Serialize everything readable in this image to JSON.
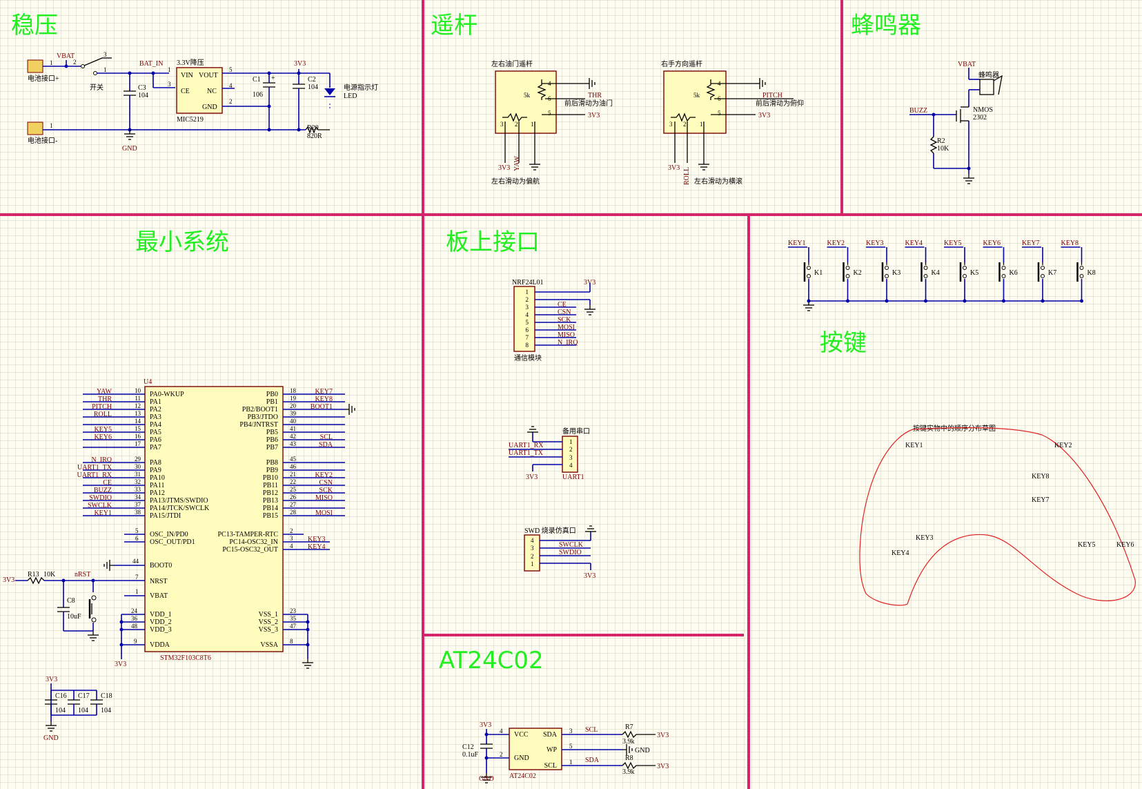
{
  "sections": {
    "regulator": "稳压",
    "joystick": "遥杆",
    "buzzer": "蜂鸣器",
    "min_system": "最小系统",
    "onboard_if": "板上接口",
    "keys": "按键",
    "eeprom": "AT24C02"
  },
  "regulator": {
    "battery_pos": "电池接口+",
    "battery_neg": "电池接口-",
    "vbat": "VBAT",
    "switch": "开关",
    "bat_in": "BAT_IN",
    "reg_title": "3.3V降压",
    "reg_part": "MIC5219",
    "pins": {
      "vin": "VIN",
      "vout": "VOUT",
      "ce": "CE",
      "nc": "NC",
      "gnd": "GND"
    },
    "c3": "C3",
    "c3v": "104",
    "c1": "C1",
    "c1v": "106",
    "c2": "C2",
    "c2v": "104",
    "net3v3": "3V3",
    "led_label": "电源指示灯",
    "led": "LED",
    "r20": "R20",
    "r20v": "820R",
    "gnd": "GND"
  },
  "joystick": {
    "left_title": "左右油门遥杆",
    "left_top_desc": "前后滑动为油门",
    "left_bottom_desc": "左右滑动为偏航",
    "left_net": "THR",
    "left_net2": "YAW",
    "right_title": "右手方向遥杆",
    "right_top_desc": "前后滑动为俯仰",
    "right_bottom_desc": "左右滑动为横滚",
    "right_net": "PITCH",
    "right_net2": "ROLL",
    "pot": "5k",
    "v3": "3V3"
  },
  "buzzer": {
    "vbat": "VBAT",
    "label": "蜂鸣器",
    "buzz": "BUZZ",
    "nmos": "NMOS",
    "part": "2302",
    "r2": "R2",
    "r2v": "10K"
  },
  "mcu": {
    "ref": "U4",
    "part": "STM32F103C8T6",
    "left_pins": [
      {
        "net": "YAW",
        "num": "10",
        "name": "PA0-WKUP"
      },
      {
        "net": "THR",
        "num": "11",
        "name": "PA1"
      },
      {
        "net": "PITCH",
        "num": "12",
        "name": "PA2"
      },
      {
        "net": "ROLL",
        "num": "13",
        "name": "PA3"
      },
      {
        "net": "",
        "num": "14",
        "name": "PA4"
      },
      {
        "net": "KEY5",
        "num": "15",
        "name": "PA5"
      },
      {
        "net": "KEY6",
        "num": "16",
        "name": "PA6"
      },
      {
        "net": "",
        "num": "17",
        "name": "PA7"
      },
      {
        "net": "N_IRQ",
        "num": "29",
        "name": "PA8"
      },
      {
        "net": "UART1_TX",
        "num": "30",
        "name": "PA9"
      },
      {
        "net": "UART1_RX",
        "num": "31",
        "name": "PA10"
      },
      {
        "net": "CE",
        "num": "32",
        "name": "PA11"
      },
      {
        "net": "BUZZ",
        "num": "33",
        "name": "PA12"
      },
      {
        "net": "SWDIO",
        "num": "34",
        "name": "PA13/JTMS/SWDIO"
      },
      {
        "net": "SWCLK",
        "num": "37",
        "name": "PA14/JTCK/SWCLK"
      },
      {
        "net": "KEY1",
        "num": "38",
        "name": "PA15/JTDI"
      }
    ],
    "right_pins": [
      {
        "net": "KEY7",
        "num": "18",
        "name": "PB0"
      },
      {
        "net": "KEY8",
        "num": "19",
        "name": "PB1"
      },
      {
        "net": "BOOT1",
        "num": "20",
        "name": "PB2/BOOT1"
      },
      {
        "net": "",
        "num": "39",
        "name": "PB3/JTDO"
      },
      {
        "net": "",
        "num": "40",
        "name": "PB4/JNTRST"
      },
      {
        "net": "",
        "num": "41",
        "name": "PB5"
      },
      {
        "net": "SCL",
        "num": "42",
        "name": "PB6"
      },
      {
        "net": "SDA",
        "num": "43",
        "name": "PB7"
      },
      {
        "net": "",
        "num": "45",
        "name": "PB8"
      },
      {
        "net": "",
        "num": "46",
        "name": "PB9"
      },
      {
        "net": "KEY2",
        "num": "21",
        "name": "PB10"
      },
      {
        "net": "CSN",
        "num": "22",
        "name": "PB11"
      },
      {
        "net": "SCK",
        "num": "25",
        "name": "PB12"
      },
      {
        "net": "MISO",
        "num": "26",
        "name": "PB13"
      },
      {
        "net": "",
        "num": "27",
        "name": "PB14"
      },
      {
        "net": "MOSI",
        "num": "28",
        "name": "PB15"
      }
    ],
    "osc_in": "OSC_IN/PD0",
    "osc_out": "OSC_OUT/PD1",
    "pc13": "PC13-TAMPER-RTC",
    "pc14": "PC14-OSC32_IN",
    "pc15": "PC15-OSC32_OUT",
    "key3": "KEY3",
    "key4": "KEY4",
    "boot0": "BOOT0",
    "nrst": "NRST",
    "vbat": "VBAT",
    "vdd1": "VDD_1",
    "vdd2": "VDD_2",
    "vdd3": "VDD_3",
    "vdda": "VDDA",
    "vss1": "VSS_1",
    "vss2": "VSS_2",
    "vss3": "VSS_3",
    "vssa": "VSSA",
    "r13": "R13",
    "r13v": "10K",
    "nrst_net": "nRST",
    "c8": "C8",
    "c8v": "10uF",
    "v3": "3V3",
    "c16": "C16",
    "c17": "C17",
    "c18": "C18",
    "cv": "104",
    "gnd": "GND"
  },
  "interfaces": {
    "nrf_title": "NRF24L01",
    "nrf_desc": "通信模块",
    "nrf_nets": [
      "",
      "",
      "CE",
      "CSN",
      "SCK",
      "MOSI",
      "MISO",
      "N_IRQ"
    ],
    "v3": "3V3",
    "uart_title": "备用串口",
    "uart_ref": "UART1",
    "uart_rx": "UART1_RX",
    "uart_tx": "UART1_TX",
    "swd_title": "SWD 烧录仿真口",
    "swclk": "SWCLK",
    "swdio": "SWDIO"
  },
  "keys": {
    "labels": [
      "KEY1",
      "KEY2",
      "KEY3",
      "KEY4",
      "KEY5",
      "KEY6",
      "KEY7",
      "KEY8"
    ],
    "refs": [
      "K1",
      "K2",
      "K3",
      "K4",
      "K5",
      "K6",
      "K7",
      "K8"
    ],
    "layout_title": "按键实物中的顺序分布草图"
  },
  "eeprom": {
    "v3": "3V3",
    "c12": "C12",
    "c12v": "0.1uF",
    "vcc": "VCC",
    "gnd": "GND",
    "sda": "SDA",
    "wp": "WP",
    "scl": "SCL",
    "part": "AT24C02",
    "scl_net": "SCL",
    "sda_net": "SDA",
    "r7": "R7",
    "r8": "R8",
    "rv": "3.9k",
    "gnd_lbl": "GND",
    "gnd_bottom": "GND"
  },
  "colors": {
    "divider": "#d4246a",
    "title": "#22ee22",
    "wire": "#0000aa",
    "net": "#7a0000",
    "ic_fill": "#fffcbe"
  }
}
